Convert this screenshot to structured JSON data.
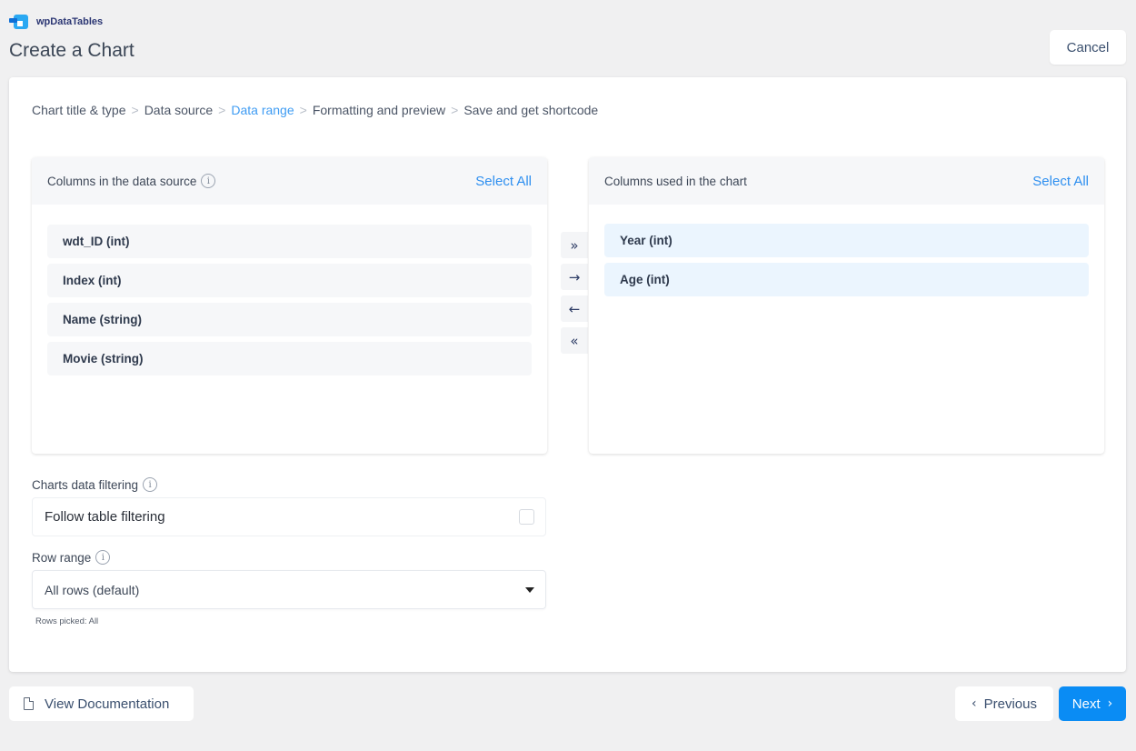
{
  "header": {
    "brand": "wpDataTables",
    "page_title": "Create a Chart",
    "cancel_label": "Cancel"
  },
  "breadcrumb": {
    "steps": [
      "Chart title & type",
      "Data source",
      "Data range",
      "Formatting and preview",
      "Save and get shortcode"
    ],
    "active_index": 2,
    "separator": ">"
  },
  "source_panel": {
    "title": "Columns in the data source",
    "info_icon": "i",
    "select_all_label": "Select All",
    "items": [
      "wdt_ID (int)",
      "Index (int)",
      "Name (string)",
      "Movie (string)"
    ]
  },
  "chart_panel": {
    "title": "Columns used in the chart",
    "select_all_label": "Select All",
    "items": [
      "Year (int)",
      "Age (int)"
    ]
  },
  "transfer_buttons": {
    "add_all": "»",
    "add": "→",
    "remove": "←",
    "remove_all": "«"
  },
  "filtering": {
    "label": "Charts data filtering",
    "info_icon": "i",
    "option_label": "Follow table filtering",
    "checked": false
  },
  "row_range": {
    "label": "Row range",
    "info_icon": "i",
    "selected": "All rows (default)",
    "hint": "Rows picked: All"
  },
  "footer": {
    "doc_label": "View Documentation",
    "previous_label": "Previous",
    "previous_chevron": "‹",
    "next_label": "Next",
    "next_chevron": "›"
  },
  "colors": {
    "accent": "#0a8cf4",
    "link": "#2e8ff0",
    "active_step": "#3f9cf3",
    "chart_item_bg": "#ebf5fe"
  }
}
